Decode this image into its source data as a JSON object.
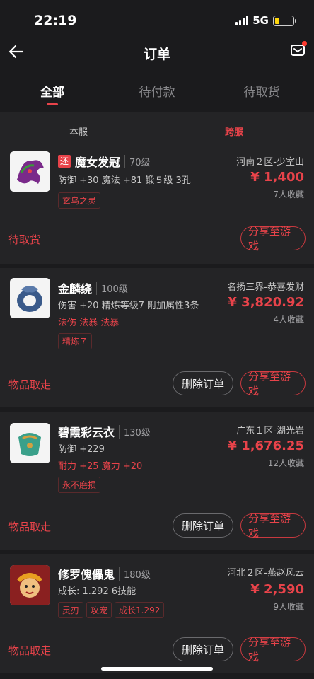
{
  "status_bar": {
    "time": "22:19",
    "network": "5G",
    "battery_level": 0.25
  },
  "nav": {
    "title": "订单"
  },
  "tabs": [
    {
      "label": "全部"
    },
    {
      "label": "待付款"
    },
    {
      "label": "待取货"
    }
  ],
  "orders": [
    {
      "server_type_local": "本服",
      "server_type_cross": "跨服",
      "tag_return": "还",
      "name": "魔女发冠",
      "level": "70级",
      "server": "河南２区-少室山",
      "price": "¥ 1,400",
      "fav": "7人收藏",
      "stats": "防御 +30  魔法 +81  锻５级  3孔",
      "tags": [
        "玄鸟之灵"
      ],
      "status": "待取货",
      "share_label": "分享至游戏"
    },
    {
      "name": "金麟绕",
      "level": "100级",
      "server": "名扬三界-恭喜发财",
      "price": "¥ 3,820.92",
      "fav": "4人收藏",
      "stats": "伤害 +20  精炼等级7  附加属性3条",
      "stats2": "法伤 法暴 法暴",
      "tags": [
        "精炼７"
      ],
      "status": "物品取走",
      "delete_label": "删除订单",
      "share_label": "分享至游戏"
    },
    {
      "name": "碧霞彩云衣",
      "level": "130级",
      "server": "广东１区-湖光岩",
      "price": "¥ 1,676.25",
      "fav": "12人收藏",
      "stats": "防御 +229",
      "stats2": "耐力 +25  魔力 +20",
      "tags": [
        "永不磨损"
      ],
      "status": "物品取走",
      "delete_label": "删除订单",
      "share_label": "分享至游戏"
    },
    {
      "name": "修罗傀儡鬼",
      "level": "180级",
      "server": "河北２区-燕赵风云",
      "price": "¥ 2,590",
      "fav": "9人收藏",
      "stats": "成长: 1.292  6技能",
      "tags": [
        "灵刃",
        "攻宠",
        "成长1.292"
      ],
      "status": "物品取走",
      "delete_label": "删除订单",
      "share_label": "分享至游戏"
    }
  ],
  "icons": {
    "back": "back-arrow-icon",
    "mail": "mail-icon"
  },
  "colors": {
    "accent": "#e8434a",
    "background": "#1b1b1d",
    "card": "#242426"
  }
}
